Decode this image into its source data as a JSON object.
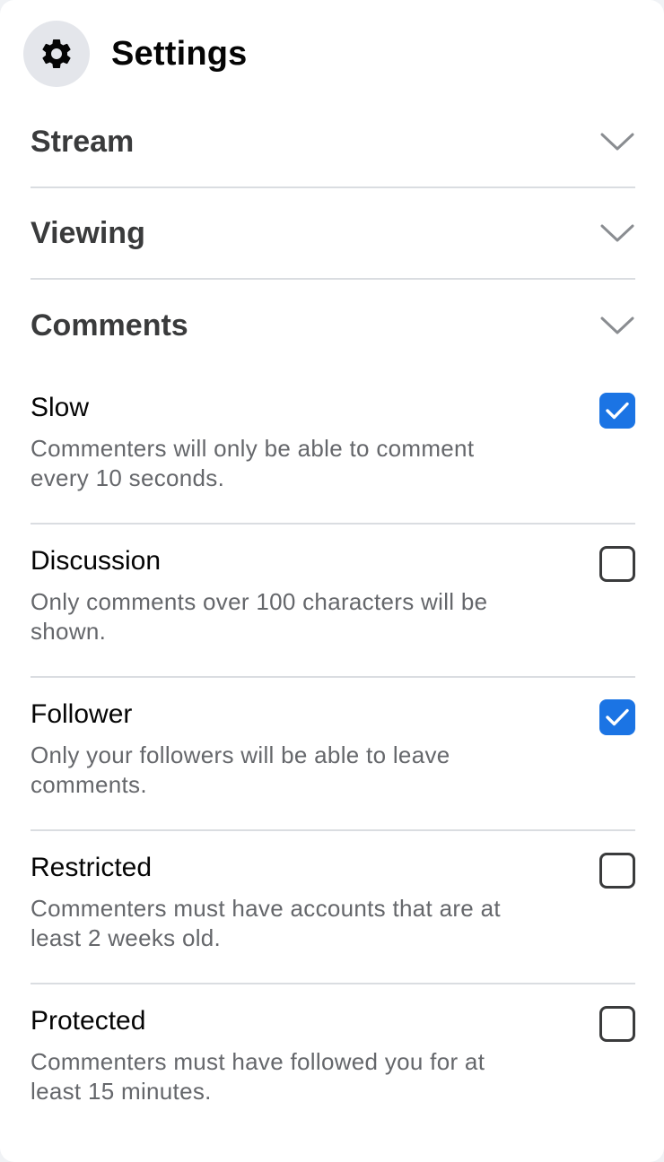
{
  "header": {
    "title": "Settings",
    "icon": "gear-icon"
  },
  "sections": [
    {
      "label": "Stream",
      "icon": "chevron-down-icon"
    },
    {
      "label": "Viewing",
      "icon": "chevron-down-icon"
    },
    {
      "label": "Comments",
      "icon": "chevron-down-icon"
    }
  ],
  "comment_options": [
    {
      "name": "Slow",
      "description": "Commenters will only be able to comment every 10 seconds.",
      "checked": true
    },
    {
      "name": "Discussion",
      "description": "Only comments over 100 characters will be shown.",
      "checked": false
    },
    {
      "name": "Follower",
      "description": "Only your followers will be able to leave comments.",
      "checked": true
    },
    {
      "name": "Restricted",
      "description": "Commenters must have accounts that are at least 2 weeks old.",
      "checked": false
    },
    {
      "name": "Protected",
      "description": "Commenters must have followed you for at least 15 minutes.",
      "checked": false
    }
  ],
  "colors": {
    "accent": "#1b74e4",
    "divider": "#dadde1",
    "secondary_text": "#65676b"
  }
}
